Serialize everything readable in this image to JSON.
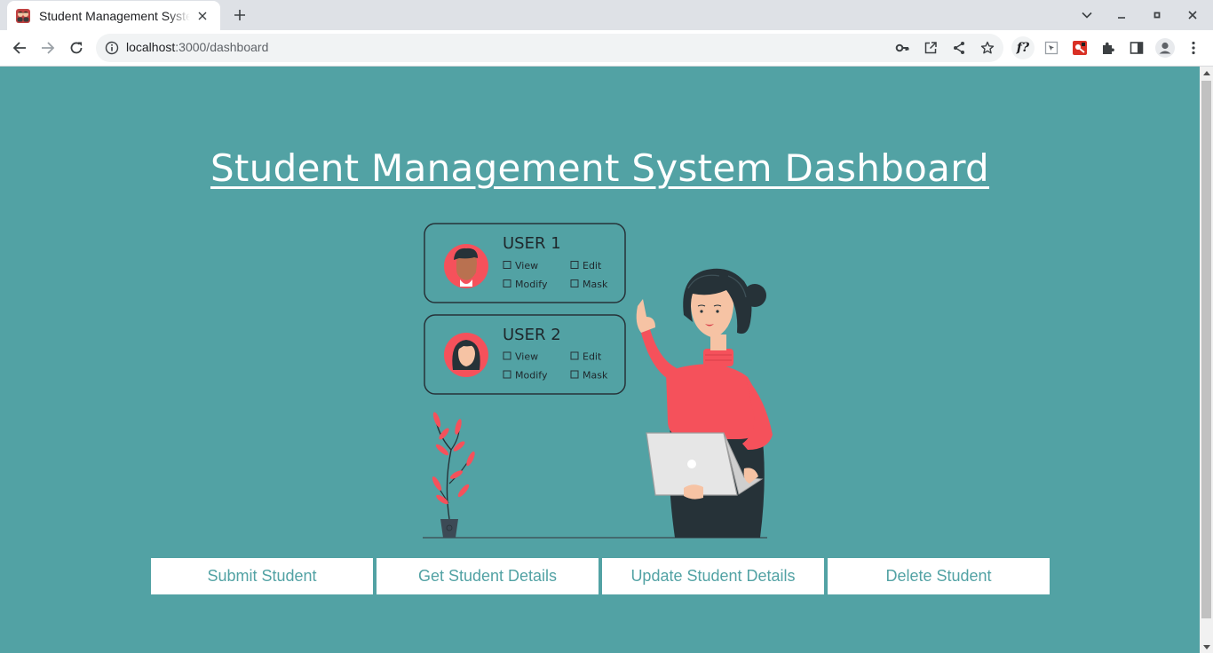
{
  "browser": {
    "tab": {
      "title": "Student Management System",
      "favicon": "app-favicon-icon"
    },
    "url": {
      "host": "localhost",
      "path": ":3000/dashboard"
    },
    "icons": [
      "back-icon",
      "forward-icon",
      "reload-icon",
      "info-icon",
      "key-icon",
      "open-in-app-icon",
      "share-icon",
      "star-icon",
      "extension-f-icon",
      "extension-cursor-icon",
      "extension-red-icon",
      "puzzle-icon",
      "side-panel-icon",
      "profile-icon",
      "menu-icon"
    ]
  },
  "page": {
    "title": "Student Management System Dashboard",
    "illustration": {
      "cards": [
        {
          "user": "USER 1",
          "options": [
            "View",
            "Edit",
            "Modify",
            "Mask"
          ]
        },
        {
          "user": "USER 2",
          "options": [
            "View",
            "Edit",
            "Modify",
            "Mask"
          ]
        }
      ]
    },
    "actions": [
      {
        "label": "Submit Student"
      },
      {
        "label": "Get Student Details"
      },
      {
        "label": "Update Student Details"
      },
      {
        "label": "Delete Student"
      }
    ]
  },
  "colors": {
    "page_bg": "#52a2a4",
    "accent_red": "#f5515b",
    "dark": "#263238",
    "button_text": "#52a2a4"
  }
}
